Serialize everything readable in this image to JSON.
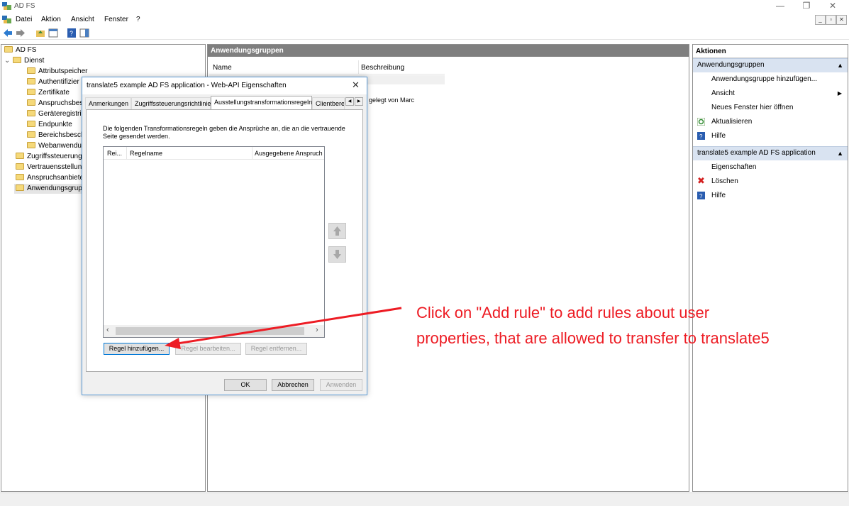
{
  "window": {
    "title": "AD FS"
  },
  "menu": [
    "Datei",
    "Aktion",
    "Ansicht",
    "Fenster",
    "?"
  ],
  "tree": {
    "root": "AD FS",
    "dienst": "Dienst",
    "dienst_children": [
      "Attributspeicher",
      "Authentifizier",
      "Zertifikate",
      "Anspruchsbesc",
      "Geräteregistrie",
      "Endpunkte",
      "Bereichsbesch",
      "Webanwendu"
    ],
    "top_items": [
      "Zugriffssteuerung",
      "Vertrauensstellun",
      "Anspruchsanbiete",
      "Anwendungsgrup"
    ]
  },
  "center": {
    "header": "Anwendungsgruppen",
    "columns": [
      "Name",
      "Beschreibung"
    ],
    "row_desc": "gelegt von Marc"
  },
  "actions": {
    "header": "Aktionen",
    "sections": [
      {
        "title": "Anwendungsgruppen",
        "items": [
          "Anwendungsgruppe hinzufügen...",
          "Ansicht",
          "Neues Fenster hier öffnen",
          "Aktualisieren",
          "Hilfe"
        ]
      },
      {
        "title": "translate5 example AD FS application",
        "items": [
          "Eigenschaften",
          "Löschen",
          "Hilfe"
        ]
      }
    ]
  },
  "dialog": {
    "title": "translate5 example AD FS application - Web-API Eigenschaften",
    "tabs": [
      "Anmerkungen",
      "Zugriffssteuerungsrichtlinie",
      "Ausstellungstransformationsregeln",
      "Clientberec"
    ],
    "description": "Die folgenden Transformationsregeln geben die Ansprüche an, die an die vertrauende Seite gesendet werden.",
    "columns": [
      "Rei...",
      "Regelname",
      "Ausgegebene Anspruch"
    ],
    "buttons": {
      "add": "Regel hinzufügen...",
      "edit": "Regel bearbeiten...",
      "remove": "Regel entfernen...",
      "ok": "OK",
      "cancel": "Abbrechen",
      "apply": "Anwenden"
    }
  },
  "annotation": {
    "line1": "Click on \"Add rule\" to add rules about user",
    "line2": "properties, that are allowed to transfer to translate5",
    "color": "#ed1c24"
  }
}
